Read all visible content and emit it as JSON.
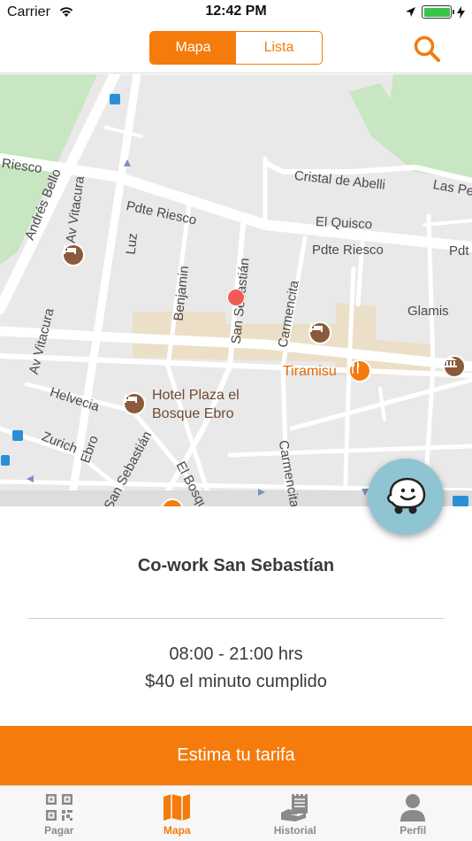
{
  "status_bar": {
    "carrier": "Carrier",
    "time": "12:42 PM",
    "battery_level": 1.0
  },
  "nav": {
    "segments": [
      "Mapa",
      "Lista"
    ],
    "active_segment": "Mapa",
    "search_icon": "search-icon"
  },
  "map": {
    "street_labels": {
      "riesco_left": "Riesco",
      "andres_bello": "Andrés Bello",
      "av_vitacura_top": "Av Vitacura",
      "pdte_riesco_1": "Pdte Riesco",
      "luz": "Luz",
      "benjamin": "Benjamin",
      "san_sebastian_top": "San Sebastián",
      "carmencita_top": "Carmencita",
      "cristal": "Cristal de Abelli",
      "las_pe": "Las Pe",
      "el_quisco": "El Quisco",
      "pdte_riesco_2": "Pdte Riesco",
      "pdt": "Pdt",
      "glamis": "Glamis",
      "av_vitacura_left": "Av Vitacura",
      "helvecia": "Helvecia",
      "zurich": "Zurich",
      "ebro": "Ebro",
      "san_sebastian_bottom": "San Sebastián",
      "el_bosque": "El Bosque",
      "carmencita_bottom": "Carmencita"
    },
    "pois": {
      "tiramisu": "Tiramisu",
      "hotel_line1": "Hotel Plaza el",
      "hotel_line2": "Bosque Ebro"
    },
    "waze_icon": "waze-icon"
  },
  "card": {
    "title": "Co-work San Sebastían",
    "hours": "08:00 - 21:00 hrs",
    "price": "$40 el minuto cumplido"
  },
  "cta": {
    "label": "Estima tu tarifa"
  },
  "colors": {
    "accent": "#f47b0c",
    "tab_inactive": "#8a8a8a",
    "waze": "#8fc4d3"
  },
  "tabs": [
    {
      "label": "Pagar",
      "icon": "qr-code-icon"
    },
    {
      "label": "Mapa",
      "icon": "map-icon"
    },
    {
      "label": "Historial",
      "icon": "history-icon"
    },
    {
      "label": "Perfil",
      "icon": "profile-icon"
    }
  ],
  "active_tab": "Mapa"
}
